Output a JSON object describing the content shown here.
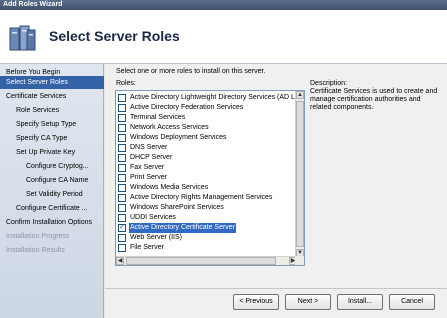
{
  "window": {
    "title": "Add Roles Wizard"
  },
  "header": {
    "title": "Select Server Roles",
    "icon": "server-roles-icon"
  },
  "sidebar": {
    "items": [
      {
        "label": "Before You Begin",
        "state": "normal"
      },
      {
        "label": "Select Server Roles",
        "state": "selected"
      },
      {
        "label": "Certificate Services",
        "state": "normal"
      },
      {
        "label": "Role Services",
        "state": "normal"
      },
      {
        "label": "Specify Setup Type",
        "state": "normal"
      },
      {
        "label": "Specify CA Type",
        "state": "normal"
      },
      {
        "label": "Set Up Private Key",
        "state": "normal"
      },
      {
        "label": "Configure Cryptog...",
        "state": "normal"
      },
      {
        "label": "Configure CA Name",
        "state": "normal"
      },
      {
        "label": "Set Validity Period",
        "state": "normal"
      },
      {
        "label": "Configure Certificate ...",
        "state": "normal"
      },
      {
        "label": "Confirm Installation Options",
        "state": "normal"
      },
      {
        "label": "Installation Progress",
        "state": "disabled"
      },
      {
        "label": "Installation Results",
        "state": "disabled"
      }
    ]
  },
  "main": {
    "instruction": "Select one or more roles to install on this server.",
    "roles_label": "Roles:",
    "roles": [
      {
        "label": "Active Directory Lightweight Directory Services (AD LI",
        "checked": false,
        "selected": false
      },
      {
        "label": "Active Directory Federation Services",
        "checked": false,
        "selected": false
      },
      {
        "label": "Terminal Services",
        "checked": false,
        "selected": false
      },
      {
        "label": "Network Access Services",
        "checked": false,
        "selected": false
      },
      {
        "label": "Windows Deployment Services",
        "checked": false,
        "selected": false
      },
      {
        "label": "DNS Server",
        "checked": false,
        "selected": false
      },
      {
        "label": "DHCP Server",
        "checked": false,
        "selected": false
      },
      {
        "label": "Fax Server",
        "checked": false,
        "selected": false
      },
      {
        "label": "Print Server",
        "checked": false,
        "selected": false
      },
      {
        "label": "Windows Media Services",
        "checked": false,
        "selected": false
      },
      {
        "label": "Active Directory Rights Management Services",
        "checked": false,
        "selected": false
      },
      {
        "label": "Windows SharePoint Services",
        "checked": false,
        "selected": false
      },
      {
        "label": "UDDI Services",
        "checked": false,
        "selected": false
      },
      {
        "label": "Active Directory Certificate Server",
        "checked": true,
        "selected": true
      },
      {
        "label": "Web Server (IIS)",
        "checked": false,
        "selected": false
      },
      {
        "label": "File Server",
        "checked": false,
        "selected": false
      }
    ],
    "description_heading": "Description:",
    "description_text": "Certificate Services is used to create and manage certification authorities and related components."
  },
  "buttons": {
    "previous": "< Previous",
    "next": "Next >",
    "install": "Install...",
    "cancel": "Cancel"
  },
  "colors": {
    "selection": "#316ac5",
    "nav_selected": "#3462a6"
  }
}
